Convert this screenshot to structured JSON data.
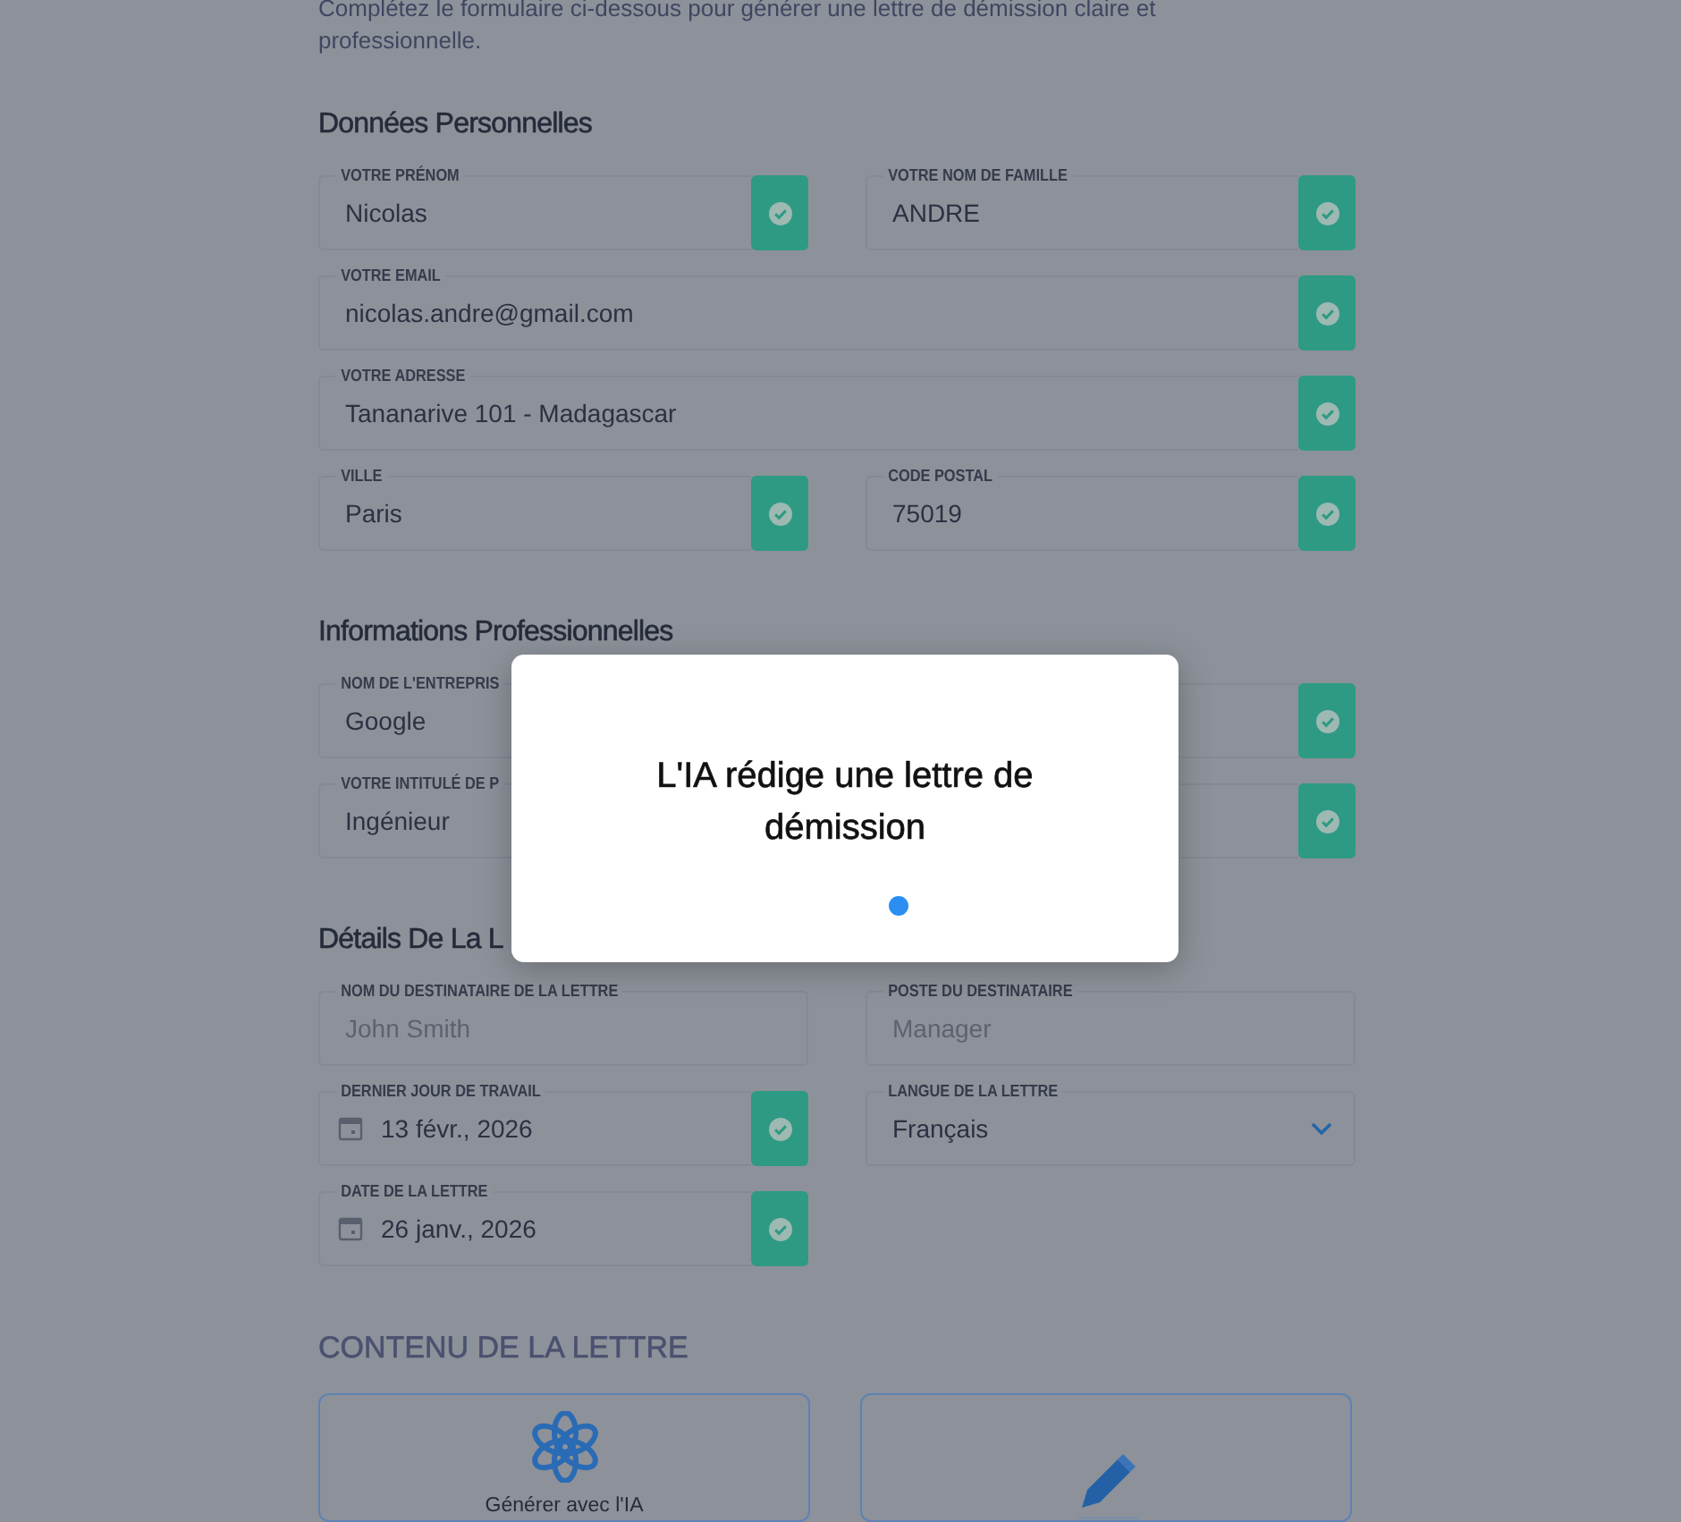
{
  "intro": "Complétez le formulaire ci-dessous pour générer une lettre de démission claire et professionnelle.",
  "sections": [
    {
      "title": "Données Personnelles",
      "rows": [
        {
          "fields": [
            {
              "kind": "text",
              "label": "VOTRE PRÉNOM",
              "value": "Nicolas",
              "valid": true
            },
            {
              "kind": "text",
              "label": "VOTRE NOM DE FAMILLE",
              "value": "ANDRE",
              "valid": true
            }
          ]
        },
        {
          "fields": [
            {
              "kind": "text",
              "label": "VOTRE EMAIL",
              "value": "nicolas.andre@gmail.com",
              "valid": true
            }
          ]
        },
        {
          "fields": [
            {
              "kind": "text",
              "label": "VOTRE ADRESSE",
              "value": "Tananarive 101 - Madagascar",
              "valid": true
            }
          ]
        },
        {
          "fields": [
            {
              "kind": "text",
              "label": "VILLE",
              "value": "Paris",
              "valid": true
            },
            {
              "kind": "text",
              "label": "CODE POSTAL",
              "value": "75019",
              "valid": true
            }
          ]
        }
      ]
    },
    {
      "title": "Informations Professionnelles",
      "rows": [
        {
          "fields": [
            {
              "kind": "text",
              "label": "NOM DE L'ENTREPRIS",
              "value": "Google"
            },
            {
              "kind": "text",
              "valid": true
            }
          ]
        },
        {
          "fields": [
            {
              "kind": "text",
              "label": "VOTRE INTITULÉ DE P",
              "value": "Ingénieur"
            },
            {
              "kind": "text",
              "valid": true
            }
          ]
        }
      ]
    },
    {
      "title": "Détails De La L",
      "rows": [
        {
          "fields": [
            {
              "kind": "text",
              "label": "NOM DU DESTINATAIRE DE LA LETTRE",
              "placeholder": "John Smith",
              "valid": false
            },
            {
              "kind": "text",
              "label": "POSTE DU DESTINATAIRE",
              "placeholder": "Manager",
              "valid": false
            }
          ]
        },
        {
          "fields": [
            {
              "kind": "date",
              "label": "DERNIER JOUR DE TRAVAIL",
              "value": "13 févr., 2026",
              "valid": true
            },
            {
              "kind": "select",
              "label": "LANGUE DE LA LETTRE",
              "value": "Français"
            }
          ]
        },
        {
          "fields": [
            {
              "kind": "date",
              "label": "DATE DE LA LETTRE",
              "value": "26 janv., 2026",
              "valid": true
            }
          ]
        }
      ]
    }
  ],
  "content": {
    "title": "CONTENU DE LA LETTRE",
    "options": [
      {
        "kind": "ai",
        "label": "Générer avec l'IA"
      },
      {
        "kind": "manual"
      }
    ]
  },
  "modal": {
    "title": "L'IA rédige une lettre de démission"
  }
}
